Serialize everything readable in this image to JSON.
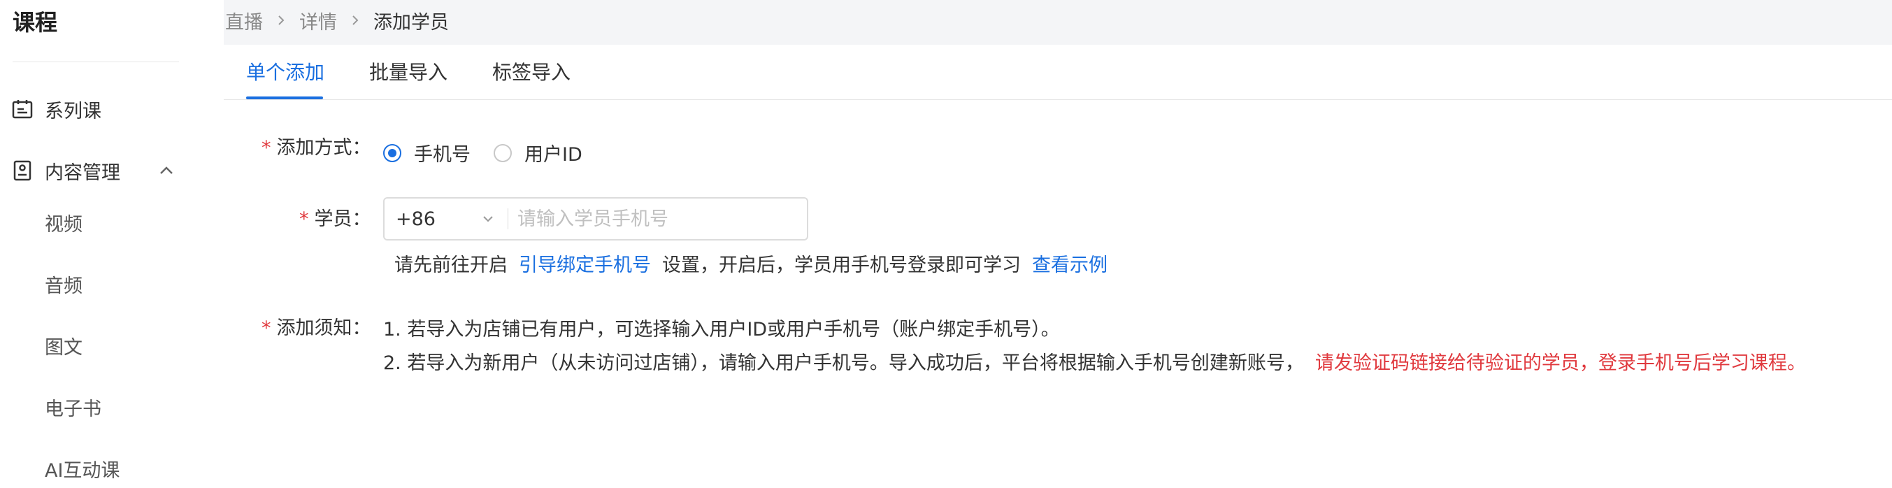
{
  "sidebar": {
    "title": "课程",
    "items": [
      {
        "label": "系列课",
        "icon": "calendar-icon"
      },
      {
        "label": "内容管理",
        "icon": "content-icon",
        "expanded": true
      }
    ],
    "sub_items": [
      "视频",
      "音频",
      "图文",
      "电子书",
      "AI互动课"
    ]
  },
  "breadcrumb": [
    "直播",
    "详情",
    "添加学员"
  ],
  "tabs": [
    "单个添加",
    "批量导入",
    "标签导入"
  ],
  "form": {
    "method_label": "添加方式：",
    "method_options": [
      "手机号",
      "用户ID"
    ],
    "method_selected": "手机号",
    "student_label": "学员：",
    "country_code": "+86",
    "phone_placeholder": "请输入学员手机号",
    "phone_value": "",
    "hint_prefix": "请先前往开启",
    "hint_link": "引导绑定手机号",
    "hint_suffix": "设置，开启后，学员用手机号登录即可学习",
    "hint_example": "查看示例",
    "notice_label": "添加须知：",
    "notice_1": "1. 若导入为店铺已有用户，可选择输入用户ID或用户手机号（账户绑定手机号）。",
    "notice_2": "2. 若导入为新用户（从未访问过店铺），请输入用户手机号。导入成功后，平台将根据输入手机号创建新账号，",
    "notice_2_warn": "请发验证码链接给待验证的学员，登录手机号后学习课程。"
  },
  "colors": {
    "accent": "#1a6fe0",
    "required": "#e0393e",
    "background": "#f4f5f7"
  }
}
